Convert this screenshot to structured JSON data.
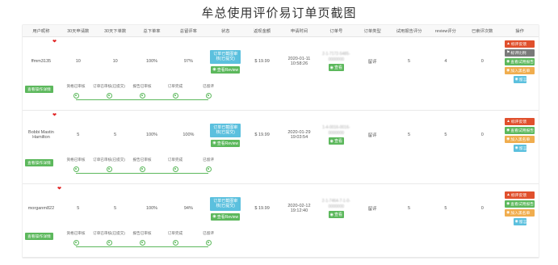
{
  "title": "牟总使用评价易订单页截图",
  "headers": [
    "用户昵称",
    "30天申请数",
    "30天下单数",
    "总下单率",
    "总留评率",
    "状态",
    "返现金额",
    "申请时间",
    "订单号",
    "订单类型",
    "试用报告评分",
    "review评分",
    "已索评次数",
    "操作"
  ],
  "labels": {
    "status_btn": "订单已截图审核(已提交)",
    "view_review": "查看Review",
    "view_order": "查看",
    "detail_btn": "查看操作详情"
  },
  "actions": {
    "mark_bad": "标评反馈",
    "flag": "标评比例",
    "report": "查看试用报告",
    "blacklist": "加入黑名单",
    "message": "留言"
  },
  "timeline_steps": [
    "资格已审核",
    "订单已审核(已提交)",
    "报告已审核",
    "订单完成",
    "已留评"
  ],
  "rows": [
    {
      "user": "ffmm3135",
      "apps": "10",
      "orders": "10",
      "order_rate": "100%",
      "review_rate": "97%",
      "amount": "$ 19.99",
      "date": "2020-01-11",
      "time": "10:58:26",
      "order_no_1": "2-1-7172-5485-",
      "order_no_2": "0000000",
      "type": "留评",
      "report_score": "5",
      "review_score": "4",
      "requests": "0",
      "actions": [
        "mark_bad",
        "flag",
        "report",
        "blacklist",
        "message"
      ]
    },
    {
      "user": "Bobbi Mastin Hamilton",
      "apps": "5",
      "orders": "5",
      "order_rate": "100%",
      "review_rate": "100%",
      "amount": "$ 19.99",
      "date": "2020-01-29",
      "time": "19:03:54",
      "order_no_1": "1-4-0016-0016-",
      "order_no_2": "0000000",
      "type": "留评",
      "report_score": "5",
      "review_score": "5",
      "requests": "0",
      "actions": [
        "mark_bad",
        "report",
        "blacklist",
        "message"
      ]
    },
    {
      "user": "morganm822",
      "apps": "5",
      "orders": "5",
      "order_rate": "100%",
      "review_rate": "94%",
      "amount": "$ 19.99",
      "date": "2020-02-12",
      "time": "19:12:40",
      "order_no_1": "2-1-7464-7-1-0-",
      "order_no_2": "0000000",
      "type": "留评",
      "report_score": "5",
      "review_score": "5",
      "requests": "0",
      "actions": [
        "mark_bad",
        "report",
        "blacklist",
        "message"
      ]
    }
  ],
  "colors": {
    "green": "#5cb85c",
    "cyan": "#5bc0de",
    "red": "#e0502d",
    "orange": "#f0ad4e",
    "gray": "#7a7a7a"
  }
}
